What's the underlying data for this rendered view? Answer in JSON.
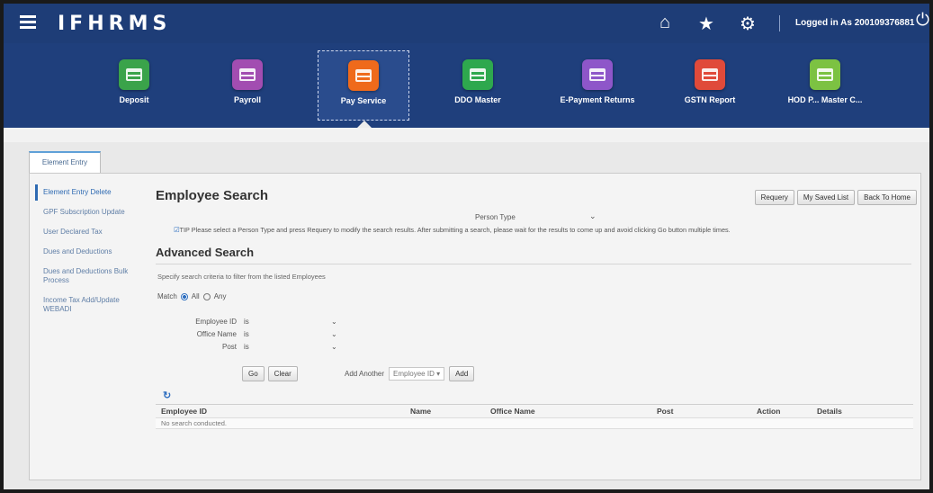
{
  "header": {
    "logo": "IFHRMS",
    "logged_in": "Logged in As 200109376881",
    "icons": [
      "home-icon",
      "star-icon",
      "gear-icon",
      "power-icon"
    ]
  },
  "nav": {
    "items": [
      {
        "label": "Deposit",
        "color": "#3aa34a"
      },
      {
        "label": "Payroll",
        "color": "#a24db1"
      },
      {
        "label": "Pay Service",
        "color": "#ef6a1b",
        "selected": true
      },
      {
        "label": "DDO Master",
        "color": "#2ea84e"
      },
      {
        "label": "E-Payment Returns",
        "color": "#8e56c9"
      },
      {
        "label": "GSTN Report",
        "color": "#e04a3a"
      },
      {
        "label": "HOD P... Master C...",
        "color": "#7cc242"
      }
    ]
  },
  "tab": {
    "label": "Element Entry"
  },
  "sidebar": {
    "items": [
      {
        "label": "Element Entry Delete"
      },
      {
        "label": "GPF Subscription Update"
      },
      {
        "label": "User Declared Tax"
      },
      {
        "label": "Dues and Deductions"
      },
      {
        "label": "Dues and Deductions Bulk Process"
      },
      {
        "label": "Income Tax Add/Update WEBADI"
      }
    ]
  },
  "main": {
    "title": "Employee Search",
    "buttons": {
      "requery": "Requery",
      "saved": "My Saved List",
      "back": "Back To Home"
    },
    "person_type_label": "Person Type",
    "tip": "TIP Please select a Person Type and press Requery to modify the search results. After submitting a search, please wait for the results to come up and avoid clicking Go button multiple times.",
    "advanced_title": "Advanced Search",
    "spec_text": "Specify search criteria to filter from the listed Employees",
    "match_label": "Match",
    "match_all": "All",
    "match_any": "Any",
    "criteria": [
      {
        "label": "Employee ID",
        "operator": "is"
      },
      {
        "label": "Office Name",
        "operator": "is"
      },
      {
        "label": "Post",
        "operator": "is"
      }
    ],
    "go": "Go",
    "clear": "Clear",
    "add_another": "Add Another",
    "add_select": "Employee ID",
    "add_btn": "Add"
  },
  "results": {
    "columns": [
      "Employee ID",
      "Name",
      "Office Name",
      "Post",
      "Action",
      "Details"
    ],
    "empty": "No search conducted."
  }
}
